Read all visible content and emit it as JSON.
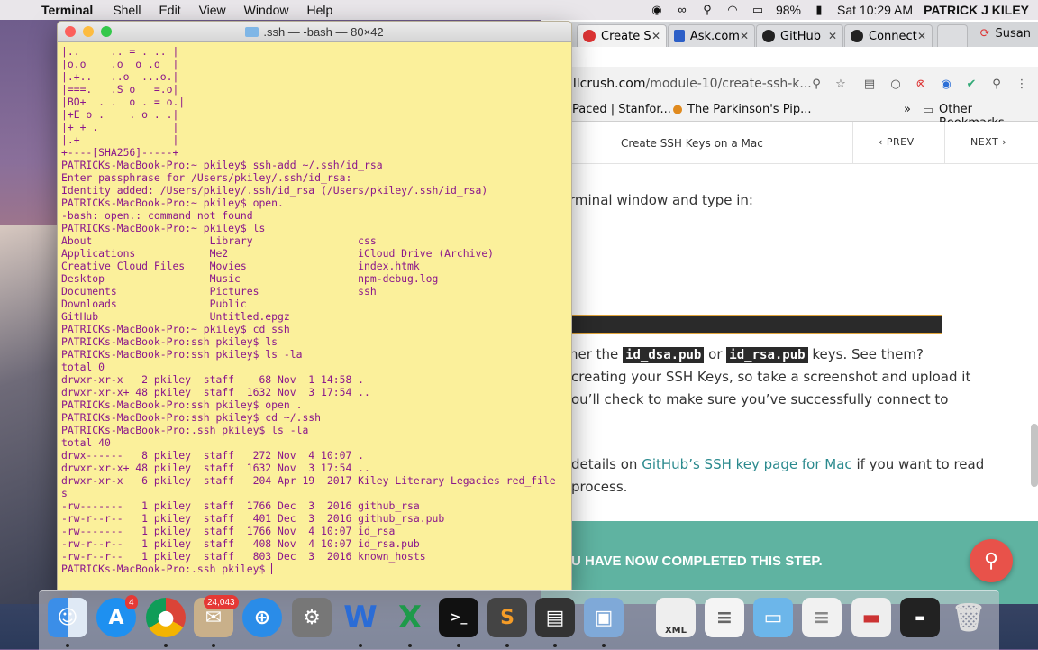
{
  "menubar": {
    "app": "Terminal",
    "items": [
      "Shell",
      "Edit",
      "View",
      "Window",
      "Help"
    ],
    "battery": "98%",
    "clock": "Sat 10:29 AM",
    "user": "PATRICK J KILEY"
  },
  "browser": {
    "tabs": [
      {
        "label": "Create S",
        "active": true
      },
      {
        "label": "Ask.com",
        "active": false
      },
      {
        "label": "GitHub",
        "active": false
      },
      {
        "label": "Connect",
        "active": false
      }
    ],
    "profile": "Susan",
    "url_domain": "illcrush.com",
    "url_path": "/module-10/create-ssh-k...",
    "bookmarks": [
      "Paced | Stanfor...",
      "The Parkinson's Pip...",
      "Other Bookmarks"
    ],
    "page_title": "Create SSH Keys on a Mac",
    "prev": "PREV",
    "next": "NEXT",
    "line_terminal": "rminal window and type in:",
    "line1_pre": "her the",
    "code1": "id_dsa.pub",
    "line1_mid": "or",
    "code2": "id_rsa.pub",
    "line1_post": "keys. See them?",
    "line2": "creating your SSH Keys, so take a screenshot and upload it",
    "line3": "ou’ll check to make sure you’ve successfully connect to",
    "line4_pre": "details on",
    "line4_link": "GitHub’s SSH key page for Mac",
    "line4_post": "if you want to read",
    "line5": "process.",
    "completed": "U HAVE NOW COMPLETED THIS STEP."
  },
  "terminal": {
    "title": ".ssh — -bash — 80×42",
    "lines": [
      "|..     .. = . .. |",
      "|o.o    .o  o .o  |",
      "|.+..   ..o  ...o.|",
      "|===.   .S o   =.o|",
      "|BO+  . .  o . = o.|",
      "|+E o .    . o . .|",
      "|+ + .            |",
      "|.+               |",
      "+----[SHA256]-----+",
      "PATRICKs-MacBook-Pro:~ pkiley$ ssh-add ~/.ssh/id_rsa",
      "Enter passphrase for /Users/pkiley/.ssh/id_rsa:",
      "Identity added: /Users/pkiley/.ssh/id_rsa (/Users/pkiley/.ssh/id_rsa)",
      "PATRICKs-MacBook-Pro:~ pkiley$ open.",
      "-bash: open.: command not found",
      "PATRICKs-MacBook-Pro:~ pkiley$ ls",
      "About                   Library                 css",
      "Applications            Me2                     iCloud Drive (Archive)",
      "Creative Cloud Files    Movies                  index.htmk",
      "Desktop                 Music                   npm-debug.log",
      "Documents               Pictures                ssh",
      "Downloads               Public",
      "GitHub                  Untitled.epgz",
      "PATRICKs-MacBook-Pro:~ pkiley$ cd ssh",
      "PATRICKs-MacBook-Pro:ssh pkiley$ ls",
      "PATRICKs-MacBook-Pro:ssh pkiley$ ls -la",
      "total 0",
      "drwxr-xr-x   2 pkiley  staff    68 Nov  1 14:58 .",
      "drwxr-xr-x+ 48 pkiley  staff  1632 Nov  3 17:54 ..",
      "PATRICKs-MacBook-Pro:ssh pkiley$ open .",
      "PATRICKs-MacBook-Pro:ssh pkiley$ cd ~/.ssh",
      "PATRICKs-MacBook-Pro:.ssh pkiley$ ls -la",
      "total 40",
      "drwx------   8 pkiley  staff   272 Nov  4 10:07 .",
      "drwxr-xr-x+ 48 pkiley  staff  1632 Nov  3 17:54 ..",
      "drwxr-xr-x   6 pkiley  staff   204 Apr 19  2017 Kiley Literary Legacies red_file",
      "s",
      "-rw-------   1 pkiley  staff  1766 Dec  3  2016 github_rsa",
      "-rw-r--r--   1 pkiley  staff   401 Dec  3  2016 github_rsa.pub",
      "-rw-------   1 pkiley  staff  1766 Nov  4 10:07 id_rsa",
      "-rw-r--r--   1 pkiley  staff   408 Nov  4 10:07 id_rsa.pub",
      "-rw-r--r--   1 pkiley  staff   803 Dec  3  2016 known_hosts"
    ],
    "prompt": "PATRICKs-MacBook-Pro:.ssh pkiley$ "
  },
  "dock": {
    "app_store_badge": "4",
    "mail_badge": "24,043",
    "xml_label": "XML"
  }
}
